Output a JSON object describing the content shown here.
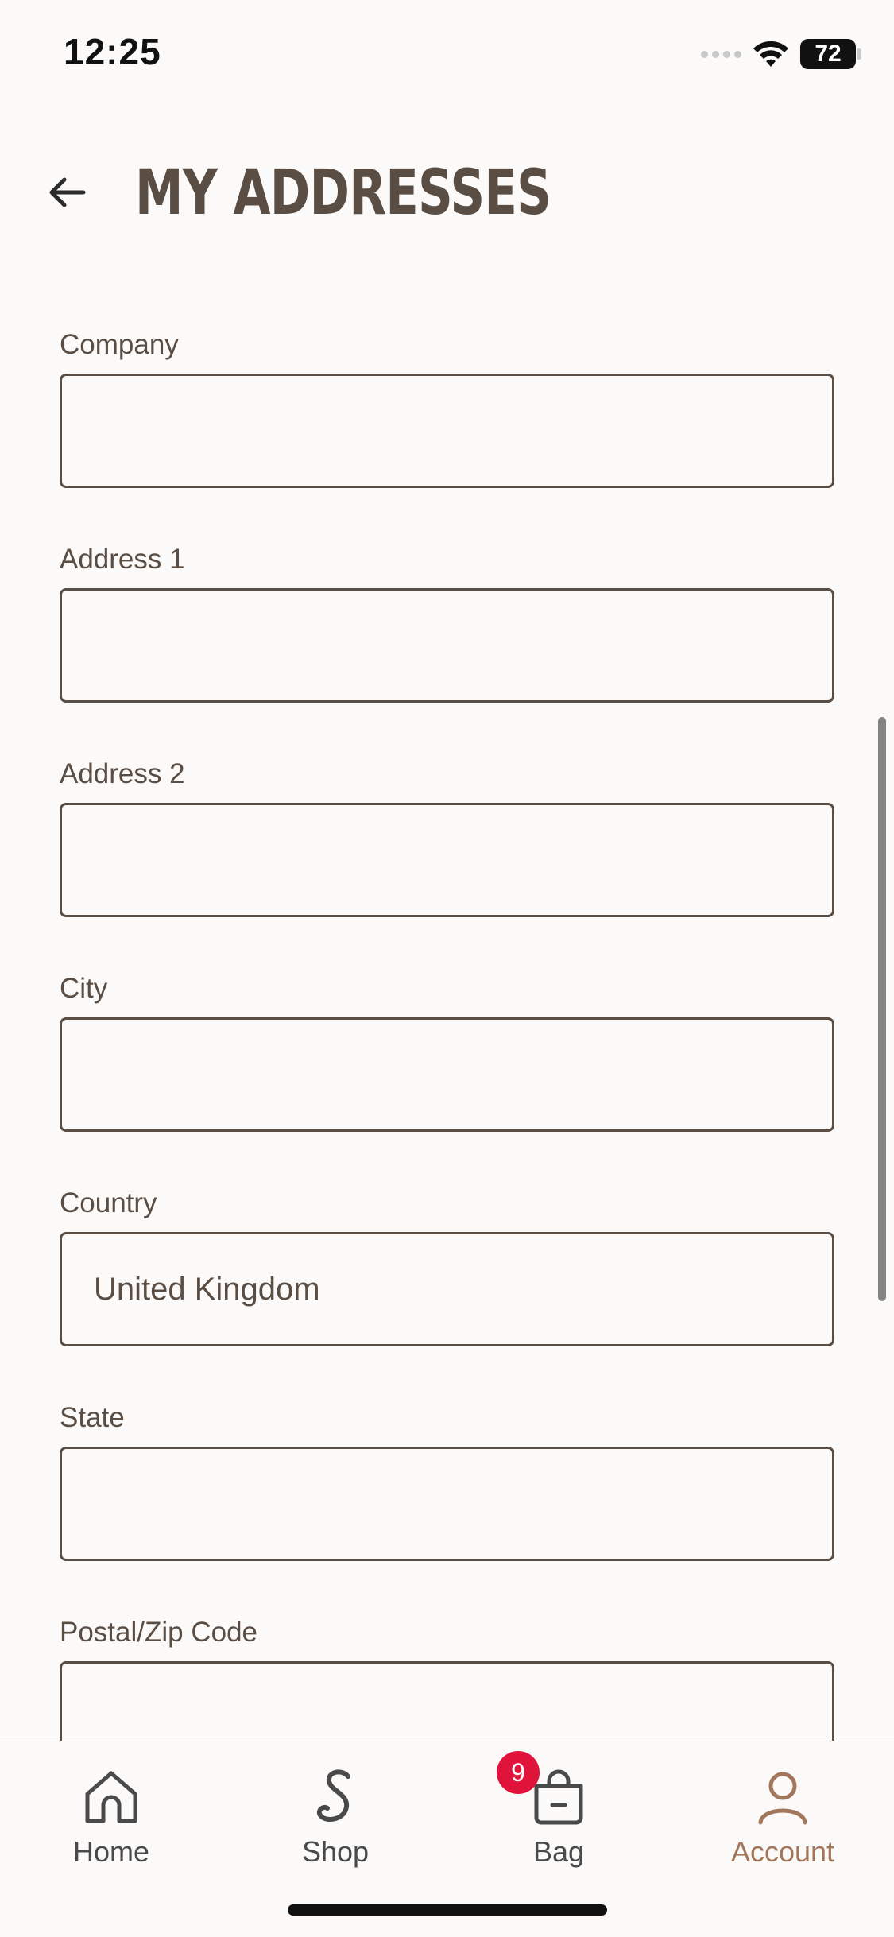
{
  "status_bar": {
    "time": "12:25",
    "battery": "72"
  },
  "header": {
    "title": "MY ADDRESSES"
  },
  "form": {
    "fields": [
      {
        "label": "Company",
        "value": ""
      },
      {
        "label": "Address 1",
        "value": ""
      },
      {
        "label": "Address 2",
        "value": ""
      },
      {
        "label": "City",
        "value": ""
      },
      {
        "label": "Country",
        "value": "United Kingdom"
      },
      {
        "label": "State",
        "value": ""
      },
      {
        "label": "Postal/Zip Code",
        "value": ""
      }
    ]
  },
  "tab_bar": {
    "tabs": [
      {
        "label": "Home",
        "icon": "home-icon"
      },
      {
        "label": "Shop",
        "icon": "shop-icon"
      },
      {
        "label": "Bag",
        "icon": "bag-icon",
        "badge": "9"
      },
      {
        "label": "Account",
        "icon": "account-icon",
        "active": true
      }
    ]
  },
  "colors": {
    "text": "#5a4d44",
    "accent": "#a2765a",
    "badge": "#e0143a",
    "background": "#fbfaf9"
  }
}
